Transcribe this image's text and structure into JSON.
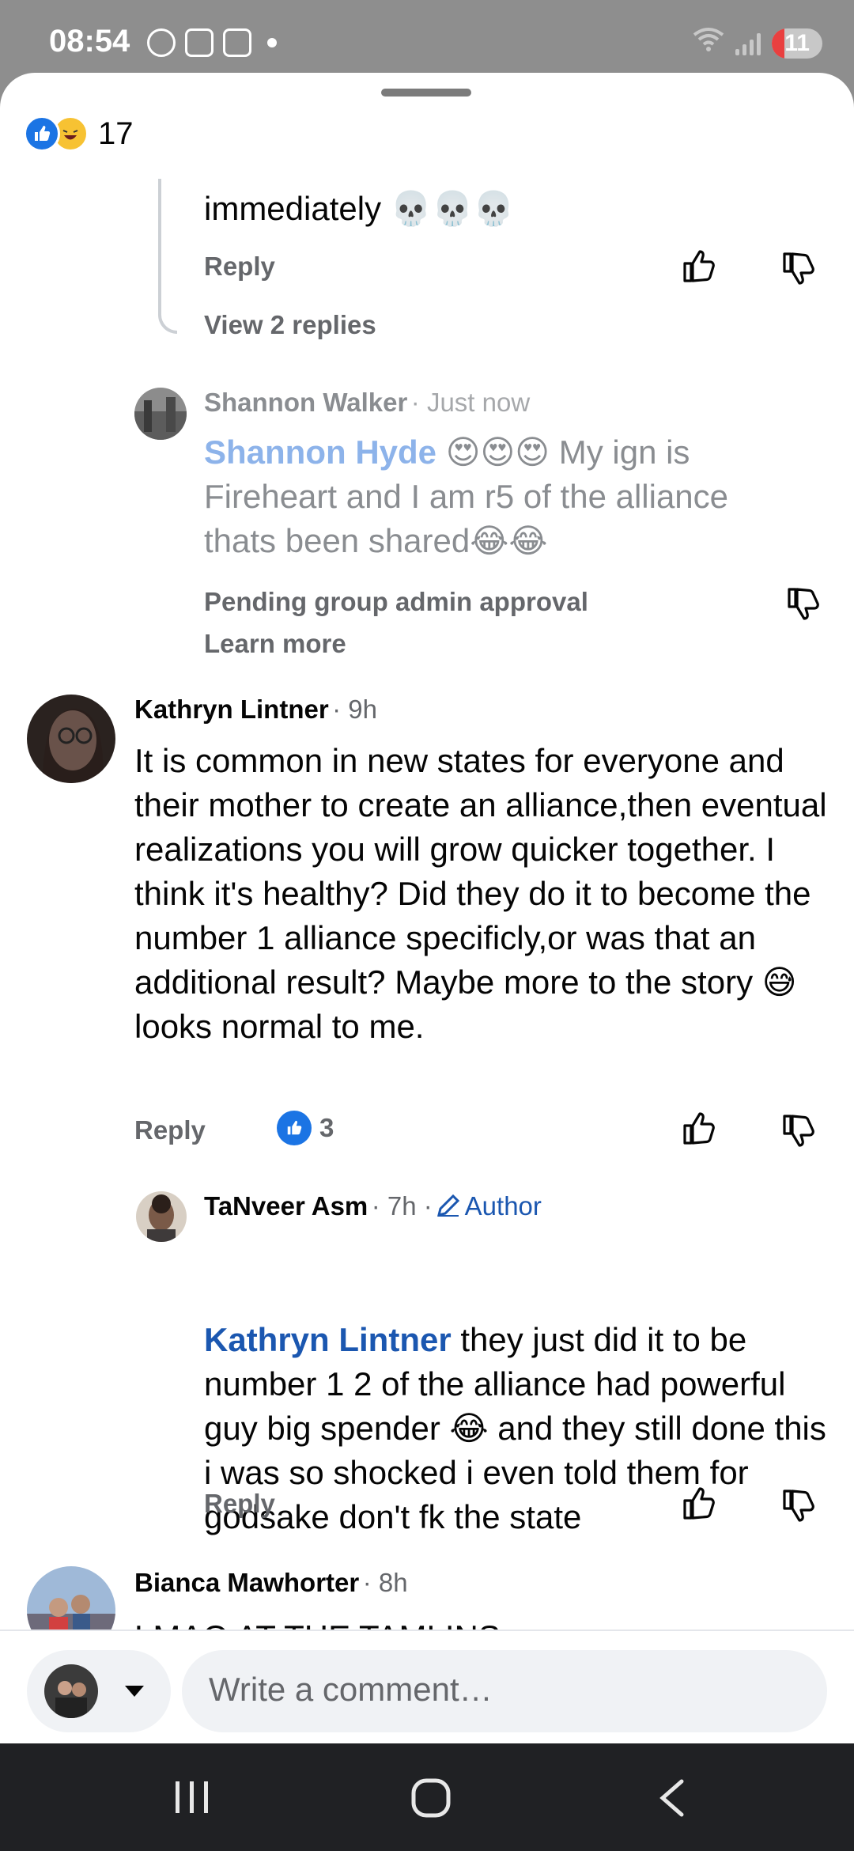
{
  "status_bar": {
    "time": "08:54",
    "battery": "11",
    "left_icons": [
      "s-icon",
      "image-icon",
      "screenshot-icon",
      "dot-icon"
    ],
    "right_icons": [
      "wifi-icon",
      "signal-icon"
    ]
  },
  "reactions": {
    "count": "17",
    "icons": [
      "like-icon",
      "haha-icon"
    ]
  },
  "thread_top": {
    "text": "immediately 💀💀💀",
    "reply_label": "Reply",
    "view_replies": "View 2 replies"
  },
  "pending_reply": {
    "author": "Shannon Walker",
    "time": "· Just now",
    "mention": "Shannon Hyde",
    "text": " 😍😍😍 My ign is Fireheart and I am r5 of the alliance thats been shared😂😂",
    "pending_label": "Pending group admin approval",
    "learn_more": "Learn more"
  },
  "comment": {
    "author": "Kathryn Lintner",
    "time": "· 9h",
    "text": "It is common in new states for everyone and their mother to create an alliance,then eventual realizations you will grow quicker together. I think it's healthy? Did they do it to become the number 1 alliance specificly,or was that an additional result? Maybe more to the story 😅 looks normal to me.",
    "reply_label": "Reply",
    "like_count": "3"
  },
  "author_reply": {
    "author": "TaNveer Asm",
    "time": "· 7h ·",
    "badge": "Author",
    "mention": "Kathryn Lintner",
    "text": "  they just did it to be number 1  2 of the alliance had powerful guy big spender 😂 and they still done this i was so shocked i even told them for godsake don't fk the state",
    "reply_label": "Reply"
  },
  "next_comment": {
    "author": "Bianca Mawhorter",
    "time": "· 8h",
    "text": "LMAO AT THE TAMLINS"
  },
  "composer": {
    "placeholder": "Write a comment…"
  },
  "nav": {
    "icons": [
      "recent-apps-icon",
      "home-icon",
      "back-icon"
    ]
  }
}
